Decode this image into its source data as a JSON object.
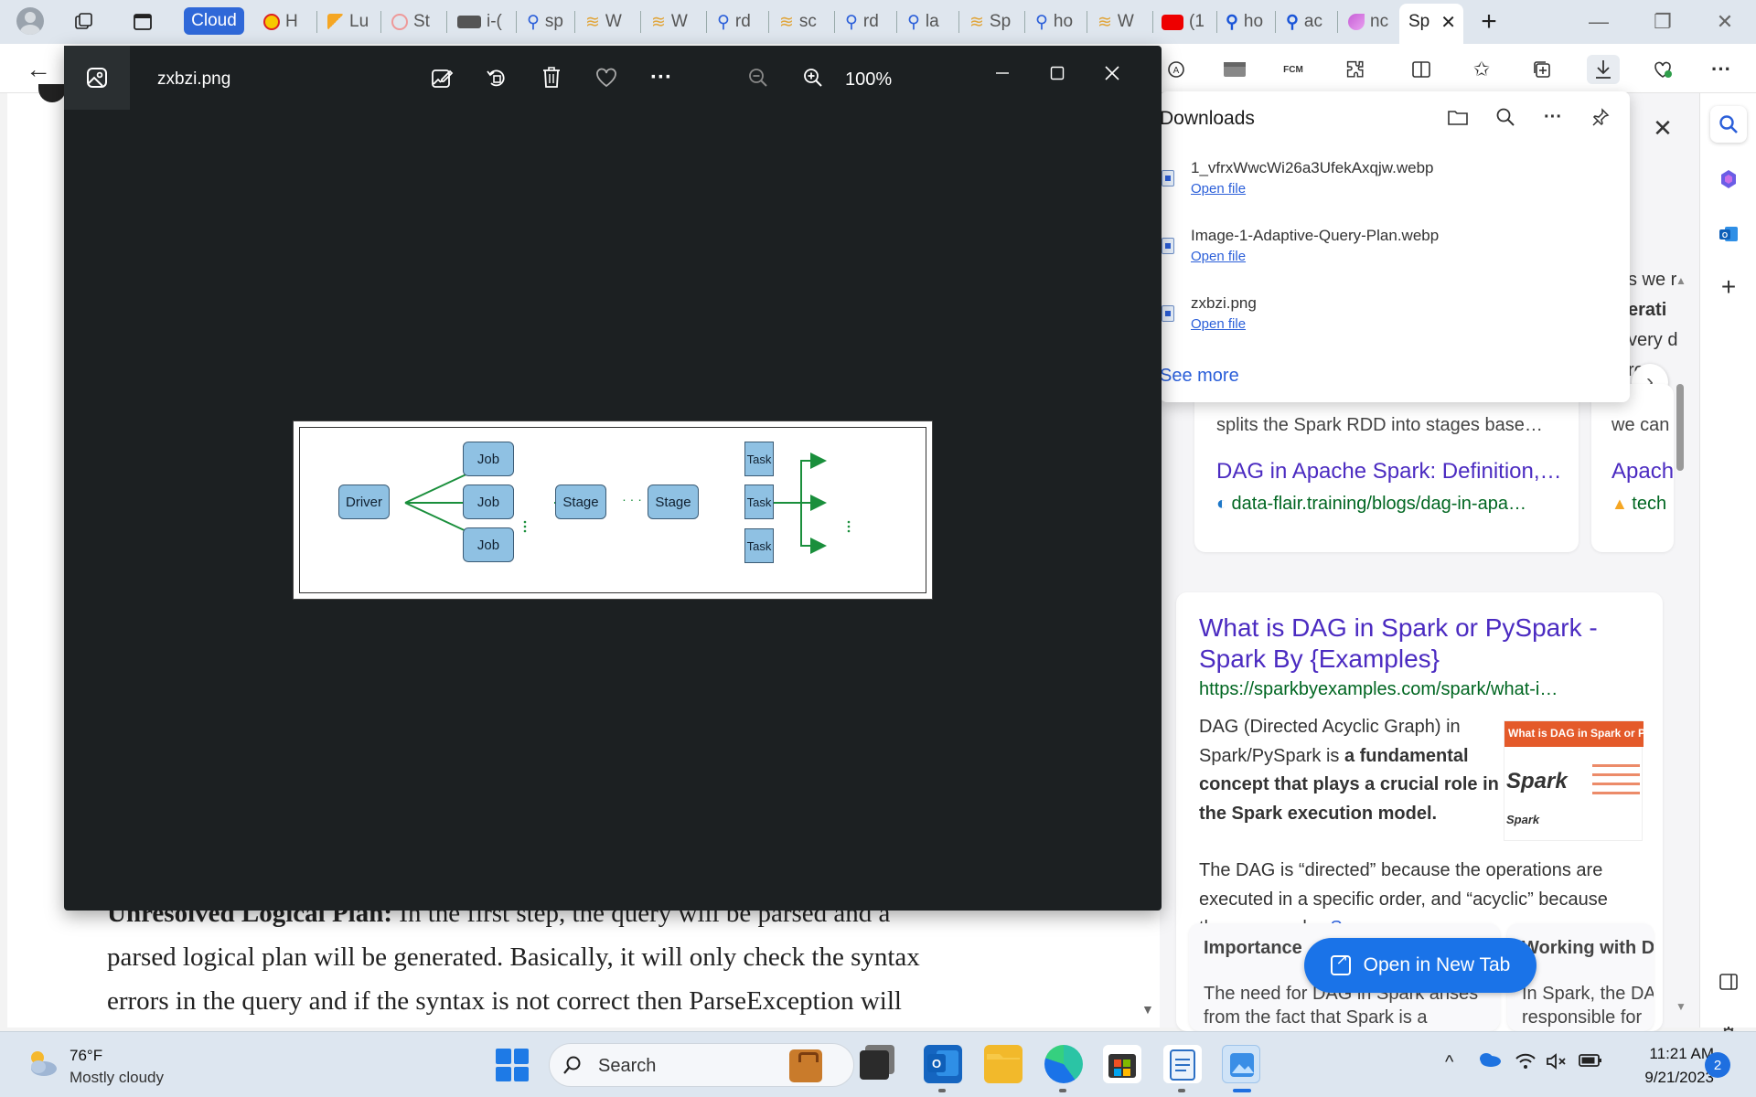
{
  "browser": {
    "tabs": [
      {
        "label": "Cloud"
      },
      {
        "label": "H"
      },
      {
        "label": "Lu"
      },
      {
        "label": "St"
      },
      {
        "label": "i-("
      },
      {
        "label": "sp"
      },
      {
        "label": "W"
      },
      {
        "label": "W"
      },
      {
        "label": "rd"
      },
      {
        "label": "sc"
      },
      {
        "label": "rd"
      },
      {
        "label": "la"
      },
      {
        "label": "Sp"
      },
      {
        "label": "ho"
      },
      {
        "label": "W"
      },
      {
        "label": "(1"
      },
      {
        "label": "ho"
      },
      {
        "label": "ac"
      },
      {
        "label": "nc"
      },
      {
        "label": "Sp"
      }
    ],
    "new_tab": "+",
    "toolbar": {
      "fcm_label": "FCM"
    }
  },
  "viewer": {
    "filename": "zxbzi.png",
    "zoom": "100%",
    "diagram": {
      "driver": "Driver",
      "jobs": [
        "Job",
        "Job",
        "Job"
      ],
      "stages": [
        "Stage",
        "Stage"
      ],
      "tasks": [
        "Task",
        "Task",
        "Task"
      ],
      "ellipsis": "· · ·"
    }
  },
  "downloads": {
    "title": "Downloads",
    "items": [
      {
        "name": "1_vfrxWwcWi26a3UfekAxqjw.webp",
        "action": "Open file"
      },
      {
        "name": "Image-1-Adaptive-Query-Plan.webp",
        "action": "Open file"
      },
      {
        "name": "zxbzi.png",
        "action": "Open file"
      }
    ],
    "see_more": "See more"
  },
  "search_results": {
    "peek_right": [
      "s we r",
      "erati",
      "very d",
      "ren",
      "ame",
      "we can"
    ],
    "card1": {
      "snippet": "splits the Spark RDD into stages base…",
      "title": "DAG in Apache Spark: Definition,…",
      "url": "data-flair.training/blogs/dag-in-apa…"
    },
    "card1_side": {
      "title": "Apach",
      "url": "tech"
    },
    "main": {
      "title": "What is DAG in Spark or PySpark - Spark By {Examples}",
      "url": "https://sparkbyexamples.com/spark/what-i…",
      "body_plain_1": "DAG (Directed Acyclic Graph) in Spark/PySpark is ",
      "body_bold": "a fundamental concept that plays a crucial role in the Spark execution model.",
      "body_plain_2": " The DAG is “directed” because the operations are executed in a specific order, and “acyclic” because there are no l… ",
      "see_more": "See more",
      "thumb_title": "What is DAG in Spark or P",
      "thumb_logo": "Spark",
      "thumb_logo_small": "Spark"
    },
    "sub_cards": [
      {
        "title": "Importance",
        "text": "The need for DAG in Spark arises from the fact that Spark is a"
      },
      {
        "title": "Working with D",
        "text": "In Spark, the DA responsible for"
      }
    ],
    "open_new_tab": "Open in New Tab"
  },
  "article": {
    "bold_lead": "Unresolved Logical Plan:",
    "line1": " In the first step, the query will be parsed and a",
    "line2": "parsed logical plan will be generated. Basically, it will only check the syntax",
    "line3": "errors in the query and if the syntax is not correct then ParseException will"
  },
  "taskbar": {
    "weather_temp": "76°F",
    "weather_desc": "Mostly cloudy",
    "search_label": "Search",
    "time": "11:21 AM",
    "date": "9/21/2023",
    "notifications": "2"
  },
  "colors": {
    "viewer_bg": "#1c2022",
    "accent": "#1a73e8",
    "diagram_node": "#8fc1e3",
    "diagram_arrow": "#1a8f3c",
    "link_purple": "#4b2bc1"
  }
}
